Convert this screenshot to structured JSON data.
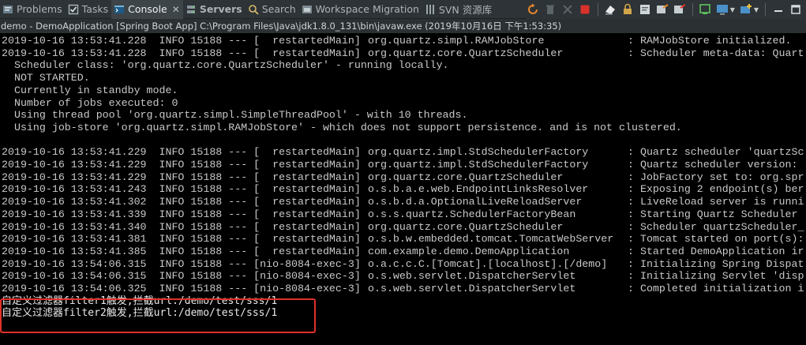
{
  "tabs": [
    {
      "label": "Problems",
      "icon": "problems-icon",
      "active": false,
      "bold": false
    },
    {
      "label": "Tasks",
      "icon": "tasks-icon",
      "active": false,
      "bold": false
    },
    {
      "label": "Console",
      "icon": "console-icon",
      "active": true,
      "bold": false,
      "close": "✕"
    },
    {
      "label": "Servers",
      "icon": "servers-icon",
      "active": false,
      "bold": true
    },
    {
      "label": "Search",
      "icon": "search-icon",
      "active": false,
      "bold": false
    },
    {
      "label": "Workspace Migration",
      "icon": "workspace-migration-icon",
      "active": false,
      "bold": false
    },
    {
      "label": "SVN 资源库",
      "icon": "svn-repository-icon",
      "active": false,
      "bold": false
    }
  ],
  "process_title": "demo - DemoApplication [Spring Boot App] C:\\Program Files\\Java\\jdk1.8.0_131\\bin\\javaw.exe (2019年10月16日 下午1:53:35)",
  "colors": {
    "highlight_border": "#e0302a",
    "terminate_red": "#d9312b",
    "accent_orange": "#e8872c"
  },
  "console_lines": [
    {
      "c1": "2019-10-16 13:53:41.228  INFO 15188 --- [  restartedMain]",
      "c2": "org.quartz.simpl.RAMJobStore",
      "c3": ": RAMJobStore initialized."
    },
    {
      "c1": "2019-10-16 13:53:41.228  INFO 15188 --- [  restartedMain]",
      "c2": "org.quartz.core.QuartzScheduler",
      "c3": ": Scheduler meta-data: Quart"
    },
    {
      "c1": "  Scheduler class: 'org.quartz.core.QuartzScheduler' - running locally.",
      "c2": "",
      "c3": ""
    },
    {
      "c1": "  NOT STARTED.",
      "c2": "",
      "c3": ""
    },
    {
      "c1": "  Currently in standby mode.",
      "c2": "",
      "c3": ""
    },
    {
      "c1": "  Number of jobs executed: 0",
      "c2": "",
      "c3": ""
    },
    {
      "c1": "  Using thread pool 'org.quartz.simpl.SimpleThreadPool' - with 10 threads.",
      "c2": "",
      "c3": ""
    },
    {
      "c1": "  Using job-store 'org.quartz.simpl.RAMJobStore' - which does not support persistence. and is not clustered.",
      "c2": "",
      "c3": ""
    },
    {
      "c1": "",
      "c2": "",
      "c3": ""
    },
    {
      "c1": "2019-10-16 13:53:41.229  INFO 15188 --- [  restartedMain]",
      "c2": "org.quartz.impl.StdSchedulerFactory",
      "c3": ": Quartz scheduler 'quartzSc"
    },
    {
      "c1": "2019-10-16 13:53:41.229  INFO 15188 --- [  restartedMain]",
      "c2": "org.quartz.impl.StdSchedulerFactory",
      "c3": ": Quartz scheduler version:"
    },
    {
      "c1": "2019-10-16 13:53:41.229  INFO 15188 --- [  restartedMain]",
      "c2": "org.quartz.core.QuartzScheduler",
      "c3": ": JobFactory set to: org.spr"
    },
    {
      "c1": "2019-10-16 13:53:41.243  INFO 15188 --- [  restartedMain]",
      "c2": "o.s.b.a.e.web.EndpointLinksResolver",
      "c3": ": Exposing 2 endpoint(s) ber"
    },
    {
      "c1": "2019-10-16 13:53:41.302  INFO 15188 --- [  restartedMain]",
      "c2": "o.s.b.d.a.OptionalLiveReloadServer",
      "c3": ": LiveReload server is runni"
    },
    {
      "c1": "2019-10-16 13:53:41.339  INFO 15188 --- [  restartedMain]",
      "c2": "o.s.s.quartz.SchedulerFactoryBean",
      "c3": ": Starting Quartz Scheduler"
    },
    {
      "c1": "2019-10-16 13:53:41.340  INFO 15188 --- [  restartedMain]",
      "c2": "org.quartz.core.QuartzScheduler",
      "c3": ": Scheduler quartzScheduler_"
    },
    {
      "c1": "2019-10-16 13:53:41.381  INFO 15188 --- [  restartedMain]",
      "c2": "o.s.b.w.embedded.tomcat.TomcatWebServer",
      "c3": ": Tomcat started on port(s):"
    },
    {
      "c1": "2019-10-16 13:53:41.385  INFO 15188 --- [  restartedMain]",
      "c2": "com.example.demo.DemoApplication",
      "c3": ": Started DemoApplication ir"
    },
    {
      "c1": "2019-10-16 13:54:06.315  INFO 15188 --- [nio-8084-exec-3]",
      "c2": "o.a.c.c.C.[Tomcat].[localhost].[/demo]",
      "c3": ": Initializing Spring Dispat"
    },
    {
      "c1": "2019-10-16 13:54:06.315  INFO 15188 --- [nio-8084-exec-3]",
      "c2": "o.s.web.servlet.DispatcherServlet",
      "c3": ": Initializing Servlet 'disp"
    },
    {
      "c1": "2019-10-16 13:54:06.325  INFO 15188 --- [nio-8084-exec-3]",
      "c2": "o.s.web.servlet.DispatcherServlet",
      "c3": ": Completed initialization i"
    },
    {
      "c1": "自定义过滤器filter1触发,拦截url:/demo/test/sss/1",
      "c2": "",
      "c3": ""
    },
    {
      "c1": "自定义过滤器filter2触发,拦截url:/demo/test/sss/1",
      "c2": "",
      "c3": ""
    }
  ]
}
